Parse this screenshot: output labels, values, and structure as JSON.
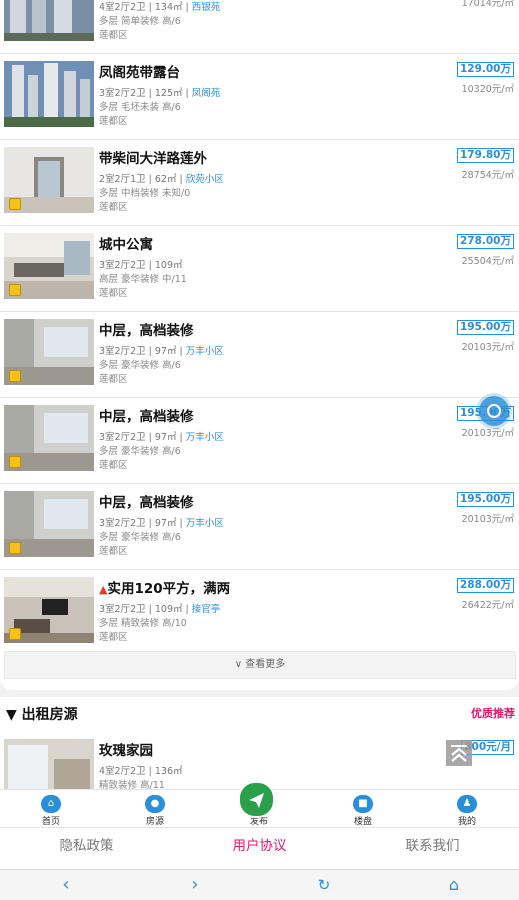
{
  "colors": {
    "accent": "#2a8fd8",
    "highlight": "#e5176f",
    "publish": "#2aa04a"
  },
  "listings": [
    {
      "title": "",
      "line1_prefix": "4室2厅2卫 | 134㎡ | ",
      "community": "西银苑",
      "line2": "多层 简单装修 高/6",
      "district": "莲都区",
      "price": "",
      "unit_price": "17014元/㎡",
      "has_vr": false
    },
    {
      "title": "凤阁苑带露台",
      "line1_prefix": "3室2厅2卫 | 125㎡ | ",
      "community": "凤阁苑",
      "line2": "多层 毛坯未装 高/6",
      "district": "莲都区",
      "price": "129.00万",
      "unit_price": "10320元/㎡",
      "has_vr": false
    },
    {
      "title": "带柴间大洋路莲外",
      "line1_prefix": "2室2厅1卫 | 62㎡ | ",
      "community": "欣苑小区",
      "line2": "多层 中档装修 未知/0",
      "district": "莲都区",
      "price": "179.80万",
      "unit_price": "28754元/㎡",
      "has_vr": true
    },
    {
      "title": "城中公寓",
      "line1_prefix": "3室2厅2卫 | 109㎡",
      "community": "",
      "line2": "高层 豪华装修 中/11",
      "district": "莲都区",
      "price": "278.00万",
      "unit_price": "25504元/㎡",
      "has_vr": true
    },
    {
      "title": "中层，高档装修",
      "line1_prefix": "3室2厅2卫 | 97㎡ | ",
      "community": "万丰小区",
      "line2": "多层 豪华装修 高/6",
      "district": "莲都区",
      "price": "195.00万",
      "unit_price": "20103元/㎡",
      "has_vr": true
    },
    {
      "title": "中层，高档装修",
      "line1_prefix": "3室2厅2卫 | 97㎡ | ",
      "community": "万丰小区",
      "line2": "多层 豪华装修 高/6",
      "district": "莲都区",
      "price": "195.00万",
      "unit_price": "20103元/㎡",
      "has_vr": true
    },
    {
      "title": "中层，高档装修",
      "line1_prefix": "3室2厅2卫 | 97㎡ | ",
      "community": "万丰小区",
      "line2": "多层 豪华装修 高/6",
      "district": "莲都区",
      "price": "195.00万",
      "unit_price": "20103元/㎡",
      "has_vr": true
    },
    {
      "title": "实用120平方，满两",
      "line1_prefix": "3室2厅2卫 | 109㎡ | ",
      "community": "接官亭",
      "line2": "多层 精致装修 高/10",
      "district": "莲都区",
      "price": "288.00万",
      "unit_price": "26422元/㎡",
      "has_vr": true
    }
  ],
  "more_label": "∨ 查看更多",
  "rent": {
    "section_title": "▼ 出租房源",
    "recommend": "优质推荐",
    "item": {
      "title": "玫瑰家园",
      "line1": "4室2厅2卫 | 136㎡",
      "line2": "精致装修 高/11",
      "price": "800元/月"
    }
  },
  "tabs": [
    {
      "label": "首页",
      "icon": "home-icon"
    },
    {
      "label": "房源",
      "icon": "house-source-icon"
    },
    {
      "label": "发布",
      "icon": "publish-icon"
    },
    {
      "label": "楼盘",
      "icon": "new-building-icon"
    },
    {
      "label": "我的",
      "icon": "user-icon"
    }
  ],
  "footer": {
    "privacy": "隐私政策",
    "agreement": "用户协议",
    "contact": "联系我们"
  },
  "navbar": {
    "back": "back-icon",
    "forward": "forward-icon",
    "refresh": "refresh-icon",
    "home": "home-icon"
  }
}
